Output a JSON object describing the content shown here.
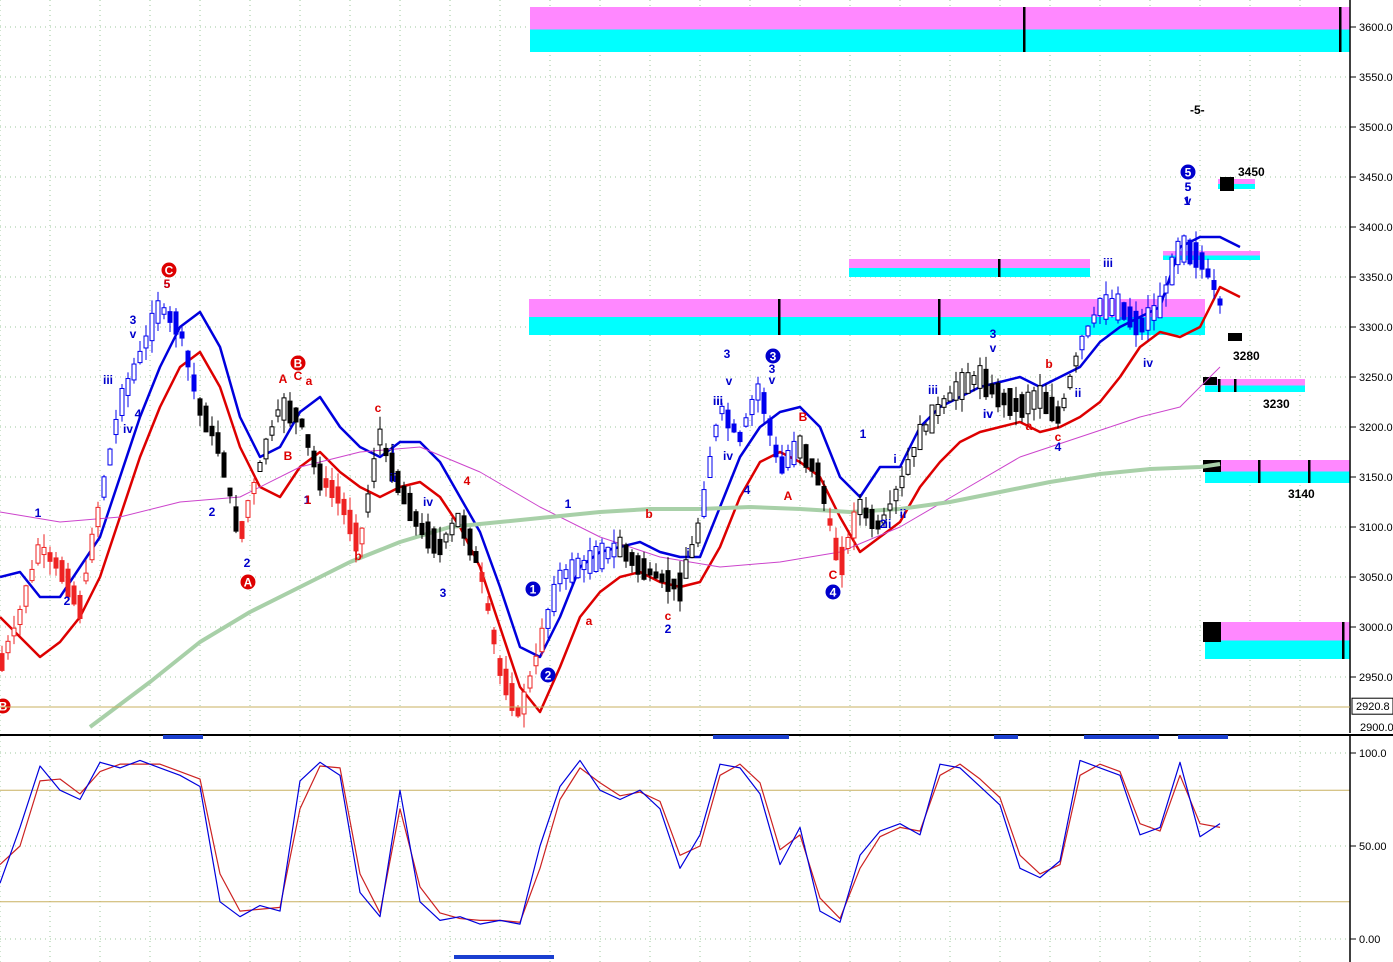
{
  "chart_data": [
    {
      "type": "candlestick",
      "title": "",
      "ylim": [
        2890,
        3640
      ],
      "y_ticks": [
        "3600.0",
        "3550.0",
        "3500.0",
        "3450.0",
        "3400.0",
        "3350.0",
        "3300.0",
        "3250.0",
        "3200.0",
        "3150.0",
        "3100.0",
        "3050.0",
        "3000.0",
        "2950.0"
      ],
      "current_price_label": "2920.8",
      "bottom_tick_label": "2900.0",
      "grid": true,
      "series": [
        {
          "name": "",
          "color": "#0000dd",
          "x": [
            0,
            20,
            40,
            60,
            80,
            100,
            120,
            140,
            160,
            180,
            200,
            220,
            240,
            260,
            280,
            300,
            320,
            340,
            360,
            380,
            400,
            420,
            440,
            460,
            480,
            500,
            520,
            540,
            560,
            580,
            600,
            620,
            640,
            660,
            680,
            700,
            720,
            740,
            760,
            780,
            800,
            820,
            840,
            860,
            880,
            900,
            920,
            940,
            960,
            980,
            1000,
            1020,
            1040,
            1060,
            1080,
            1100,
            1120,
            1140,
            1160,
            1180,
            1200,
            1220,
            1240
          ],
          "values": [
            3050,
            3055,
            3030,
            3030,
            3060,
            3090,
            3150,
            3210,
            3260,
            3300,
            3315,
            3280,
            3210,
            3170,
            3180,
            3215,
            3230,
            3200,
            3180,
            3170,
            3185,
            3185,
            3165,
            3130,
            3095,
            3040,
            2980,
            2970,
            3010,
            3060,
            3075,
            3080,
            3085,
            3075,
            3070,
            3070,
            3120,
            3170,
            3200,
            3215,
            3220,
            3200,
            3150,
            3130,
            3160,
            3160,
            3200,
            3220,
            3230,
            3240,
            3245,
            3250,
            3240,
            3250,
            3260,
            3285,
            3300,
            3310,
            3320,
            3380,
            3390,
            3390,
            3380
          ]
        },
        {
          "name": "",
          "color": "#dd0000",
          "x": [
            0,
            20,
            40,
            60,
            80,
            100,
            120,
            140,
            160,
            180,
            200,
            220,
            240,
            260,
            280,
            300,
            320,
            340,
            360,
            380,
            400,
            420,
            440,
            460,
            480,
            500,
            520,
            540,
            560,
            580,
            600,
            620,
            640,
            660,
            680,
            700,
            720,
            740,
            760,
            780,
            800,
            820,
            840,
            860,
            880,
            900,
            920,
            940,
            960,
            980,
            1000,
            1020,
            1040,
            1060,
            1080,
            1100,
            1120,
            1140,
            1160,
            1180,
            1200,
            1220,
            1240
          ],
          "values": [
            3010,
            2990,
            2970,
            2985,
            3010,
            3050,
            3110,
            3170,
            3220,
            3260,
            3275,
            3240,
            3180,
            3140,
            3130,
            3160,
            3175,
            3155,
            3140,
            3130,
            3140,
            3145,
            3130,
            3100,
            3060,
            3000,
            2940,
            2915,
            2960,
            3010,
            3035,
            3050,
            3055,
            3045,
            3040,
            3045,
            3080,
            3130,
            3165,
            3175,
            3165,
            3150,
            3110,
            3075,
            3090,
            3105,
            3140,
            3165,
            3185,
            3195,
            3200,
            3205,
            3195,
            3200,
            3210,
            3225,
            3250,
            3280,
            3295,
            3290,
            3300,
            3340,
            3330
          ]
        },
        {
          "name": "",
          "color": "#cc44cc",
          "x": [
            0,
            60,
            120,
            180,
            240,
            300,
            360,
            420,
            480,
            540,
            600,
            660,
            720,
            780,
            840,
            900,
            960,
            1020,
            1080,
            1140,
            1180,
            1220
          ],
          "values": [
            3115,
            3105,
            3110,
            3125,
            3130,
            3160,
            3175,
            3180,
            3155,
            3120,
            3090,
            3070,
            3060,
            3065,
            3075,
            3100,
            3135,
            3170,
            3190,
            3210,
            3220,
            3260
          ]
        },
        {
          "name": "",
          "color": "#a8d0a8",
          "x": [
            90,
            150,
            200,
            250,
            300,
            350,
            400,
            450,
            500,
            550,
            600,
            650,
            700,
            750,
            800,
            850,
            900,
            950,
            1000,
            1050,
            1100,
            1150,
            1200,
            1220
          ],
          "values": [
            2900,
            2945,
            2985,
            3015,
            3040,
            3065,
            3085,
            3100,
            3105,
            3110,
            3115,
            3118,
            3118,
            3120,
            3118,
            3115,
            3118,
            3125,
            3135,
            3145,
            3153,
            3158,
            3160,
            3163
          ]
        }
      ],
      "target_zones": [
        {
          "x1": 530,
          "x2": 1350,
          "top": 3620,
          "bottom": 3575
        },
        {
          "x1": 849,
          "x2": 1090,
          "top": 3368,
          "bottom": 3350
        },
        {
          "x1": 529,
          "x2": 1205,
          "top": 3328,
          "bottom": 3292
        },
        {
          "x1": 1218,
          "x2": 1255,
          "top": 3448,
          "bottom": 3438
        },
        {
          "x1": 1163,
          "x2": 1260,
          "top": 3376,
          "bottom": 3367
        },
        {
          "x1": 1205,
          "x2": 1305,
          "top": 3248,
          "bottom": 3235
        },
        {
          "x1": 1205,
          "x2": 1350,
          "top": 3167,
          "bottom": 3144
        },
        {
          "x1": 1205,
          "x2": 1350,
          "top": 3005,
          "bottom": 2968
        }
      ],
      "zone_labels": [
        "3450",
        "3280",
        "3230",
        "3140",
        "-5-"
      ],
      "wave_labels": {
        "blue": [
          "1",
          "2",
          "3",
          "v",
          "iii",
          "iv",
          "4",
          "5",
          "2",
          "i",
          "ii",
          "3",
          "iv",
          "1",
          "2",
          "1",
          "i",
          "ii",
          "iii",
          "iv",
          "v",
          "3",
          "1",
          "2",
          "3",
          "v",
          "iii",
          "iv",
          "4",
          "5",
          "1",
          "i",
          "2",
          "ii",
          "iii",
          "iv",
          "3",
          "v",
          "4",
          "ii",
          "iii",
          "iv",
          "5",
          "v"
        ],
        "red": [
          "5",
          "A",
          "C",
          "a",
          "B",
          "1",
          "c",
          "b",
          "4",
          "a",
          "b",
          "c",
          "B",
          "A",
          "C",
          "a",
          "b",
          "c"
        ],
        "circled": [
          {
            "label": "C",
            "color": "#dd0000"
          },
          {
            "label": "B",
            "color": "#dd0000"
          },
          {
            "label": "A",
            "color": "#dd0000"
          },
          {
            "label": "B",
            "color": "#dd0000"
          },
          {
            "label": "1",
            "color": "#0000cc"
          },
          {
            "label": "2",
            "color": "#0000cc"
          },
          {
            "label": "3",
            "color": "#0000cc"
          },
          {
            "label": "4",
            "color": "#0000cc"
          },
          {
            "label": "5",
            "color": "#0000cc"
          }
        ]
      }
    },
    {
      "type": "line",
      "title": "",
      "ylim": [
        0,
        100
      ],
      "y_ticks": [
        "100.0",
        "50.00",
        "0.00"
      ],
      "reference_lines": [
        80,
        20
      ],
      "series": [
        {
          "name": "",
          "color": "#0000dd",
          "x": [
            0,
            20,
            40,
            60,
            80,
            100,
            120,
            140,
            160,
            180,
            200,
            220,
            240,
            260,
            280,
            300,
            320,
            340,
            360,
            380,
            400,
            420,
            440,
            460,
            480,
            500,
            520,
            540,
            560,
            580,
            600,
            620,
            640,
            660,
            680,
            700,
            720,
            740,
            760,
            780,
            800,
            820,
            840,
            860,
            880,
            900,
            920,
            940,
            960,
            980,
            1000,
            1020,
            1040,
            1060,
            1080,
            1100,
            1120,
            1140,
            1160,
            1180,
            1200,
            1220
          ],
          "values": [
            30,
            60,
            93,
            80,
            75,
            95,
            92,
            96,
            92,
            88,
            82,
            20,
            12,
            18,
            15,
            85,
            95,
            88,
            25,
            12,
            80,
            20,
            10,
            12,
            8,
            10,
            8,
            50,
            82,
            96,
            80,
            75,
            80,
            70,
            38,
            56,
            94,
            92,
            78,
            40,
            60,
            15,
            9,
            45,
            58,
            62,
            56,
            94,
            92,
            82,
            72,
            38,
            33,
            42,
            96,
            92,
            88,
            56,
            60,
            95,
            55,
            62
          ]
        },
        {
          "name": "",
          "color": "#cc2222",
          "x": [
            0,
            20,
            40,
            60,
            80,
            100,
            120,
            140,
            160,
            180,
            200,
            220,
            240,
            260,
            280,
            300,
            320,
            340,
            360,
            380,
            400,
            420,
            440,
            460,
            480,
            500,
            520,
            540,
            560,
            580,
            600,
            620,
            640,
            660,
            680,
            700,
            720,
            740,
            760,
            780,
            800,
            820,
            840,
            860,
            880,
            900,
            920,
            940,
            960,
            980,
            1000,
            1020,
            1040,
            1060,
            1080,
            1100,
            1120,
            1140,
            1160,
            1180,
            1200,
            1220
          ],
          "values": [
            40,
            50,
            85,
            86,
            78,
            90,
            94,
            94,
            94,
            90,
            86,
            35,
            15,
            16,
            17,
            70,
            93,
            92,
            35,
            14,
            70,
            28,
            14,
            11,
            10,
            10,
            9,
            38,
            75,
            92,
            84,
            77,
            79,
            74,
            45,
            50,
            88,
            94,
            84,
            48,
            56,
            22,
            11,
            38,
            55,
            60,
            58,
            88,
            94,
            86,
            76,
            45,
            35,
            40,
            88,
            94,
            90,
            62,
            58,
            88,
            62,
            60
          ]
        }
      ]
    }
  ],
  "colors": {
    "magenta_zone": "#ff88ff",
    "cyan_zone": "#00ffff",
    "up_candle": "#ffffff",
    "down_candle": "#000000",
    "bull_red": "#ee2222",
    "bull_blue": "#0000ee",
    "grid": "#9ec99e",
    "axis_border": "#000000",
    "ref_line": "#c8b060"
  }
}
